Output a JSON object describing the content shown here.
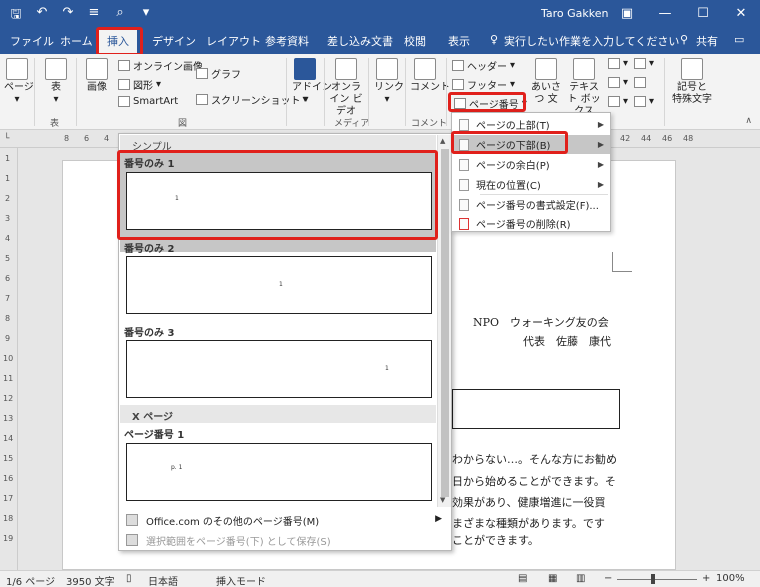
{
  "titlebar": {
    "user": "Taro Gakken",
    "qat": [
      "save-icon",
      "undo-icon",
      "redo-icon",
      "format-painter-icon",
      "print-preview-icon",
      "customize-icon"
    ]
  },
  "tabs": [
    "ファイル",
    "ホーム",
    "挿入",
    "デザイン",
    "レイアウト",
    "参考資料",
    "差し込み文書",
    "校閲",
    "表示"
  ],
  "tell_me": "実行したい作業を入力してください",
  "share": "共有",
  "ribbon": {
    "pages": "ページ",
    "table": "表",
    "table_group": "表",
    "picture": "画像",
    "online_picture": "オンライン画像",
    "shapes": "図形",
    "smartart": "SmartArt",
    "chart": "グラフ",
    "screenshot": "スクリーンショット",
    "fig_group": "図",
    "addins": "アドイン",
    "online_video": "オンライン ビデオ",
    "link": "リンク",
    "media_group": "メディア",
    "comment": "コメント",
    "comment_group": "コメント",
    "header": "ヘッダー",
    "footer": "フッター",
    "page_number": "ページ番号",
    "greeting": "あいさつ 文",
    "textbox": "テキスト ボックス",
    "symbol": "記号と 特殊文字"
  },
  "ruler": {
    "h": [
      "8",
      "6",
      "4",
      "42",
      "44",
      "46",
      "48"
    ],
    "v": [
      "1",
      "1",
      "2",
      "3",
      "4",
      "5",
      "6",
      "7",
      "8",
      "9",
      "10",
      "11",
      "12",
      "13",
      "14",
      "15",
      "16",
      "17",
      "18",
      "19"
    ]
  },
  "gallery": {
    "section1": "シンプル",
    "item1": "番号のみ 1",
    "item2": "番号のみ 2",
    "item3": "番号のみ 3",
    "section2": "X ページ",
    "item4": "ページ番号 1",
    "num": "1",
    "num4": "p. 1",
    "more": "Office.com のその他のページ番号(M)",
    "save": "選択範囲をページ番号(下) として保存(S)"
  },
  "menu": {
    "top": "ページの上部(T)",
    "bottom": "ページの下部(B)",
    "margin": "ページの余白(P)",
    "current": "現在の位置(C)",
    "format": "ページ番号の書式設定(F)...",
    "remove": "ページ番号の削除(R)"
  },
  "document": {
    "org": "NPO　ウォーキング友の会",
    "rep": "代表　佐藤　康代",
    "lines": [
      "わからない…。そんな方にお勧め",
      "日から始めることができます。そ",
      "効果があり、健康増進に一役買",
      "まざまな種類があります。です",
      "ことができます。"
    ]
  },
  "status": {
    "pages": "1/6 ページ",
    "words": "3950 文字",
    "lang": "日本語",
    "mode": "挿入モード",
    "zoom": "100%"
  },
  "zoom_percent": 100
}
